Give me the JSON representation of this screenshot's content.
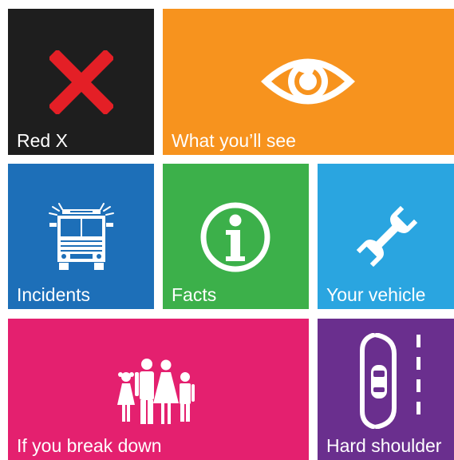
{
  "tiles": {
    "red_x": {
      "label": "Red X",
      "color": "#1e1e1e",
      "icon": "red-x-icon",
      "icon_color": "#e41f26"
    },
    "what_youll_see": {
      "label": "What you’ll see",
      "color": "#f7931e",
      "icon": "eye-icon"
    },
    "incidents": {
      "label": "Incidents",
      "color": "#1d6fb8",
      "icon": "fire-engine-icon"
    },
    "facts": {
      "label": "Facts",
      "color": "#3cb04a",
      "icon": "info-icon"
    },
    "your_vehicle": {
      "label": "Your vehicle",
      "color": "#2aa5e0",
      "icon": "wrench-icon"
    },
    "if_you_break_down": {
      "label": "If you break down",
      "color": "#e4206f",
      "icon": "family-icon"
    },
    "hard_shoulder": {
      "label": "Hard shoulder",
      "color": "#6a2f8e",
      "icon": "hard-shoulder-car-icon"
    }
  }
}
